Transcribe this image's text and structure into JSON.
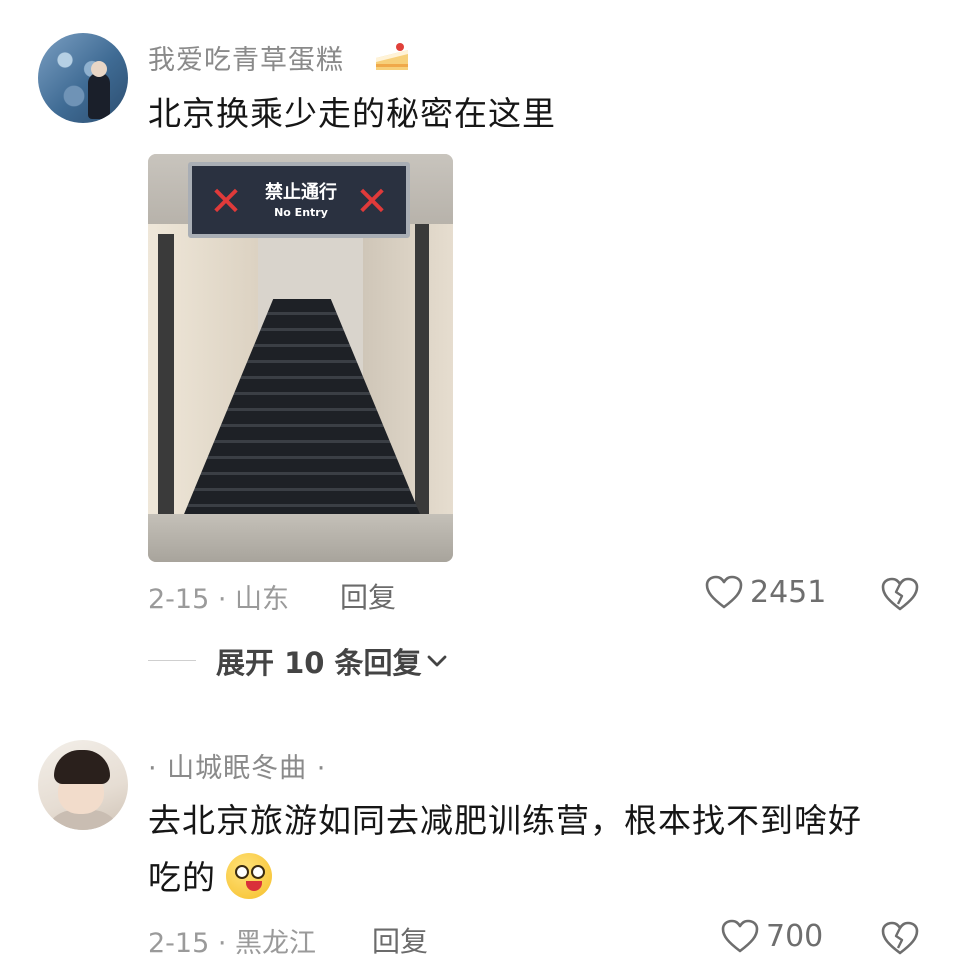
{
  "comments": [
    {
      "username": "我爱吃青草蛋糕",
      "username_emoji": "cake-icon",
      "text": "北京换乘少走的秘密在这里",
      "photo_sign": {
        "zh": "禁止通行",
        "en": "No Entry"
      },
      "date_location": "2-15 · 山东",
      "reply_label": "回复",
      "likes": "2451",
      "expand_label": "展开 10 条回复"
    },
    {
      "username": "· 山城眠冬曲 ·",
      "text_line1": "去北京旅游如同去减肥训练营，根本找不到啥好",
      "text_line2": "吃的",
      "date_location": "2-15 · 黑龙江",
      "reply_label": "回复",
      "likes": "700"
    }
  ],
  "colors": {
    "text_primary": "#161616",
    "text_muted": "#9a9a9a",
    "icon": "#6e6e6e"
  }
}
